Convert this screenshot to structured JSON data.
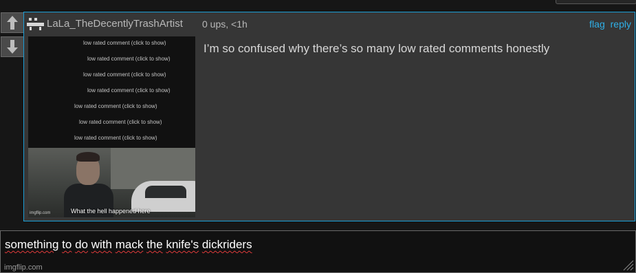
{
  "vote": {
    "up_icon": "arrow-up-icon",
    "down_icon": "arrow-down-icon"
  },
  "comment": {
    "username": "LaLa_TheDecentlyTrashArtist",
    "meta": "0 ups, <1h",
    "actions": {
      "flag": "flag",
      "reply": "reply"
    },
    "text": "I’m so confused why there’s so many low rated comments honestly",
    "meme": {
      "low_rated_lines": [
        "low rated comment (click to show)",
        "low rated comment (click to show)",
        "low rated comment (click to show)",
        "low rated comment (click to show)",
        "low rated comment (click to show)",
        "low rated comment (click to show)",
        "low rated comment (click to show)"
      ],
      "caption": "What the hell happened here",
      "watermark": "imgflip.com"
    }
  },
  "caption_box": {
    "words": [
      "something",
      "to",
      "do",
      "with",
      "mack",
      "the",
      "knife's",
      "dickriders"
    ],
    "watermark": "imgflip.com"
  },
  "colors": {
    "accent": "#1a9fd8",
    "link": "#2fb0e8",
    "spellcheck": "#e23b3b"
  }
}
